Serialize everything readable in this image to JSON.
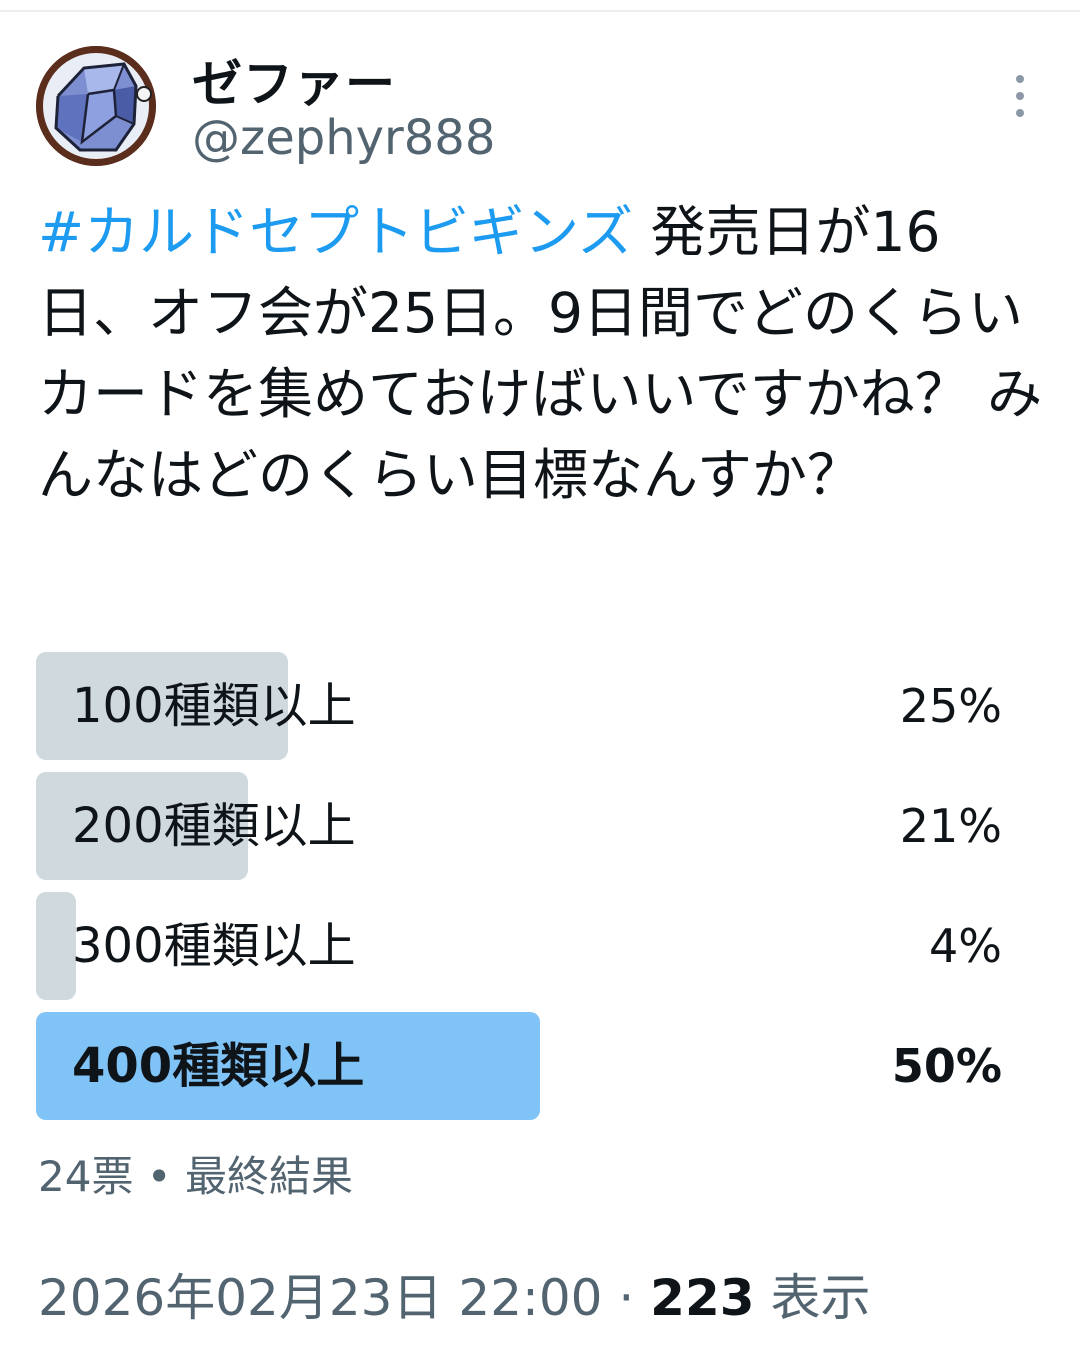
{
  "user": {
    "display_name": "ゼファー",
    "handle": "@zephyr888"
  },
  "tweet": {
    "hashtag": "#カルドセプトビギンズ",
    "text": " 発売日が16日、オフ会が25日。9日間でどのくらいカードを集めておけばいいですかね？ みんなはどのくらい目標なんすか？"
  },
  "poll": {
    "options": [
      {
        "label": "100種類以上",
        "percent": "25%",
        "fraction": 0.25
      },
      {
        "label": "200種類以上",
        "percent": "21%",
        "fraction": 0.21
      },
      {
        "label": "300種類以上",
        "percent": "4%",
        "fraction": 0.04
      },
      {
        "label": "400種類以上",
        "percent": "50%",
        "fraction": 0.5
      }
    ],
    "votes": "24票",
    "separator": " • ",
    "status": "最終結果"
  },
  "meta": {
    "timestamp": "2026年02月23日 22:00",
    "separator": " · ",
    "views_count": "223",
    "views_label": " 表示"
  },
  "icons": {
    "more": "more-vertical-icon",
    "avatar": "avatar-image"
  },
  "colors": {
    "hashtag": "#1d9bf0",
    "poll_bar": "#cfd9de",
    "poll_winner": "#7fc3f7",
    "muted_text": "#536471"
  }
}
